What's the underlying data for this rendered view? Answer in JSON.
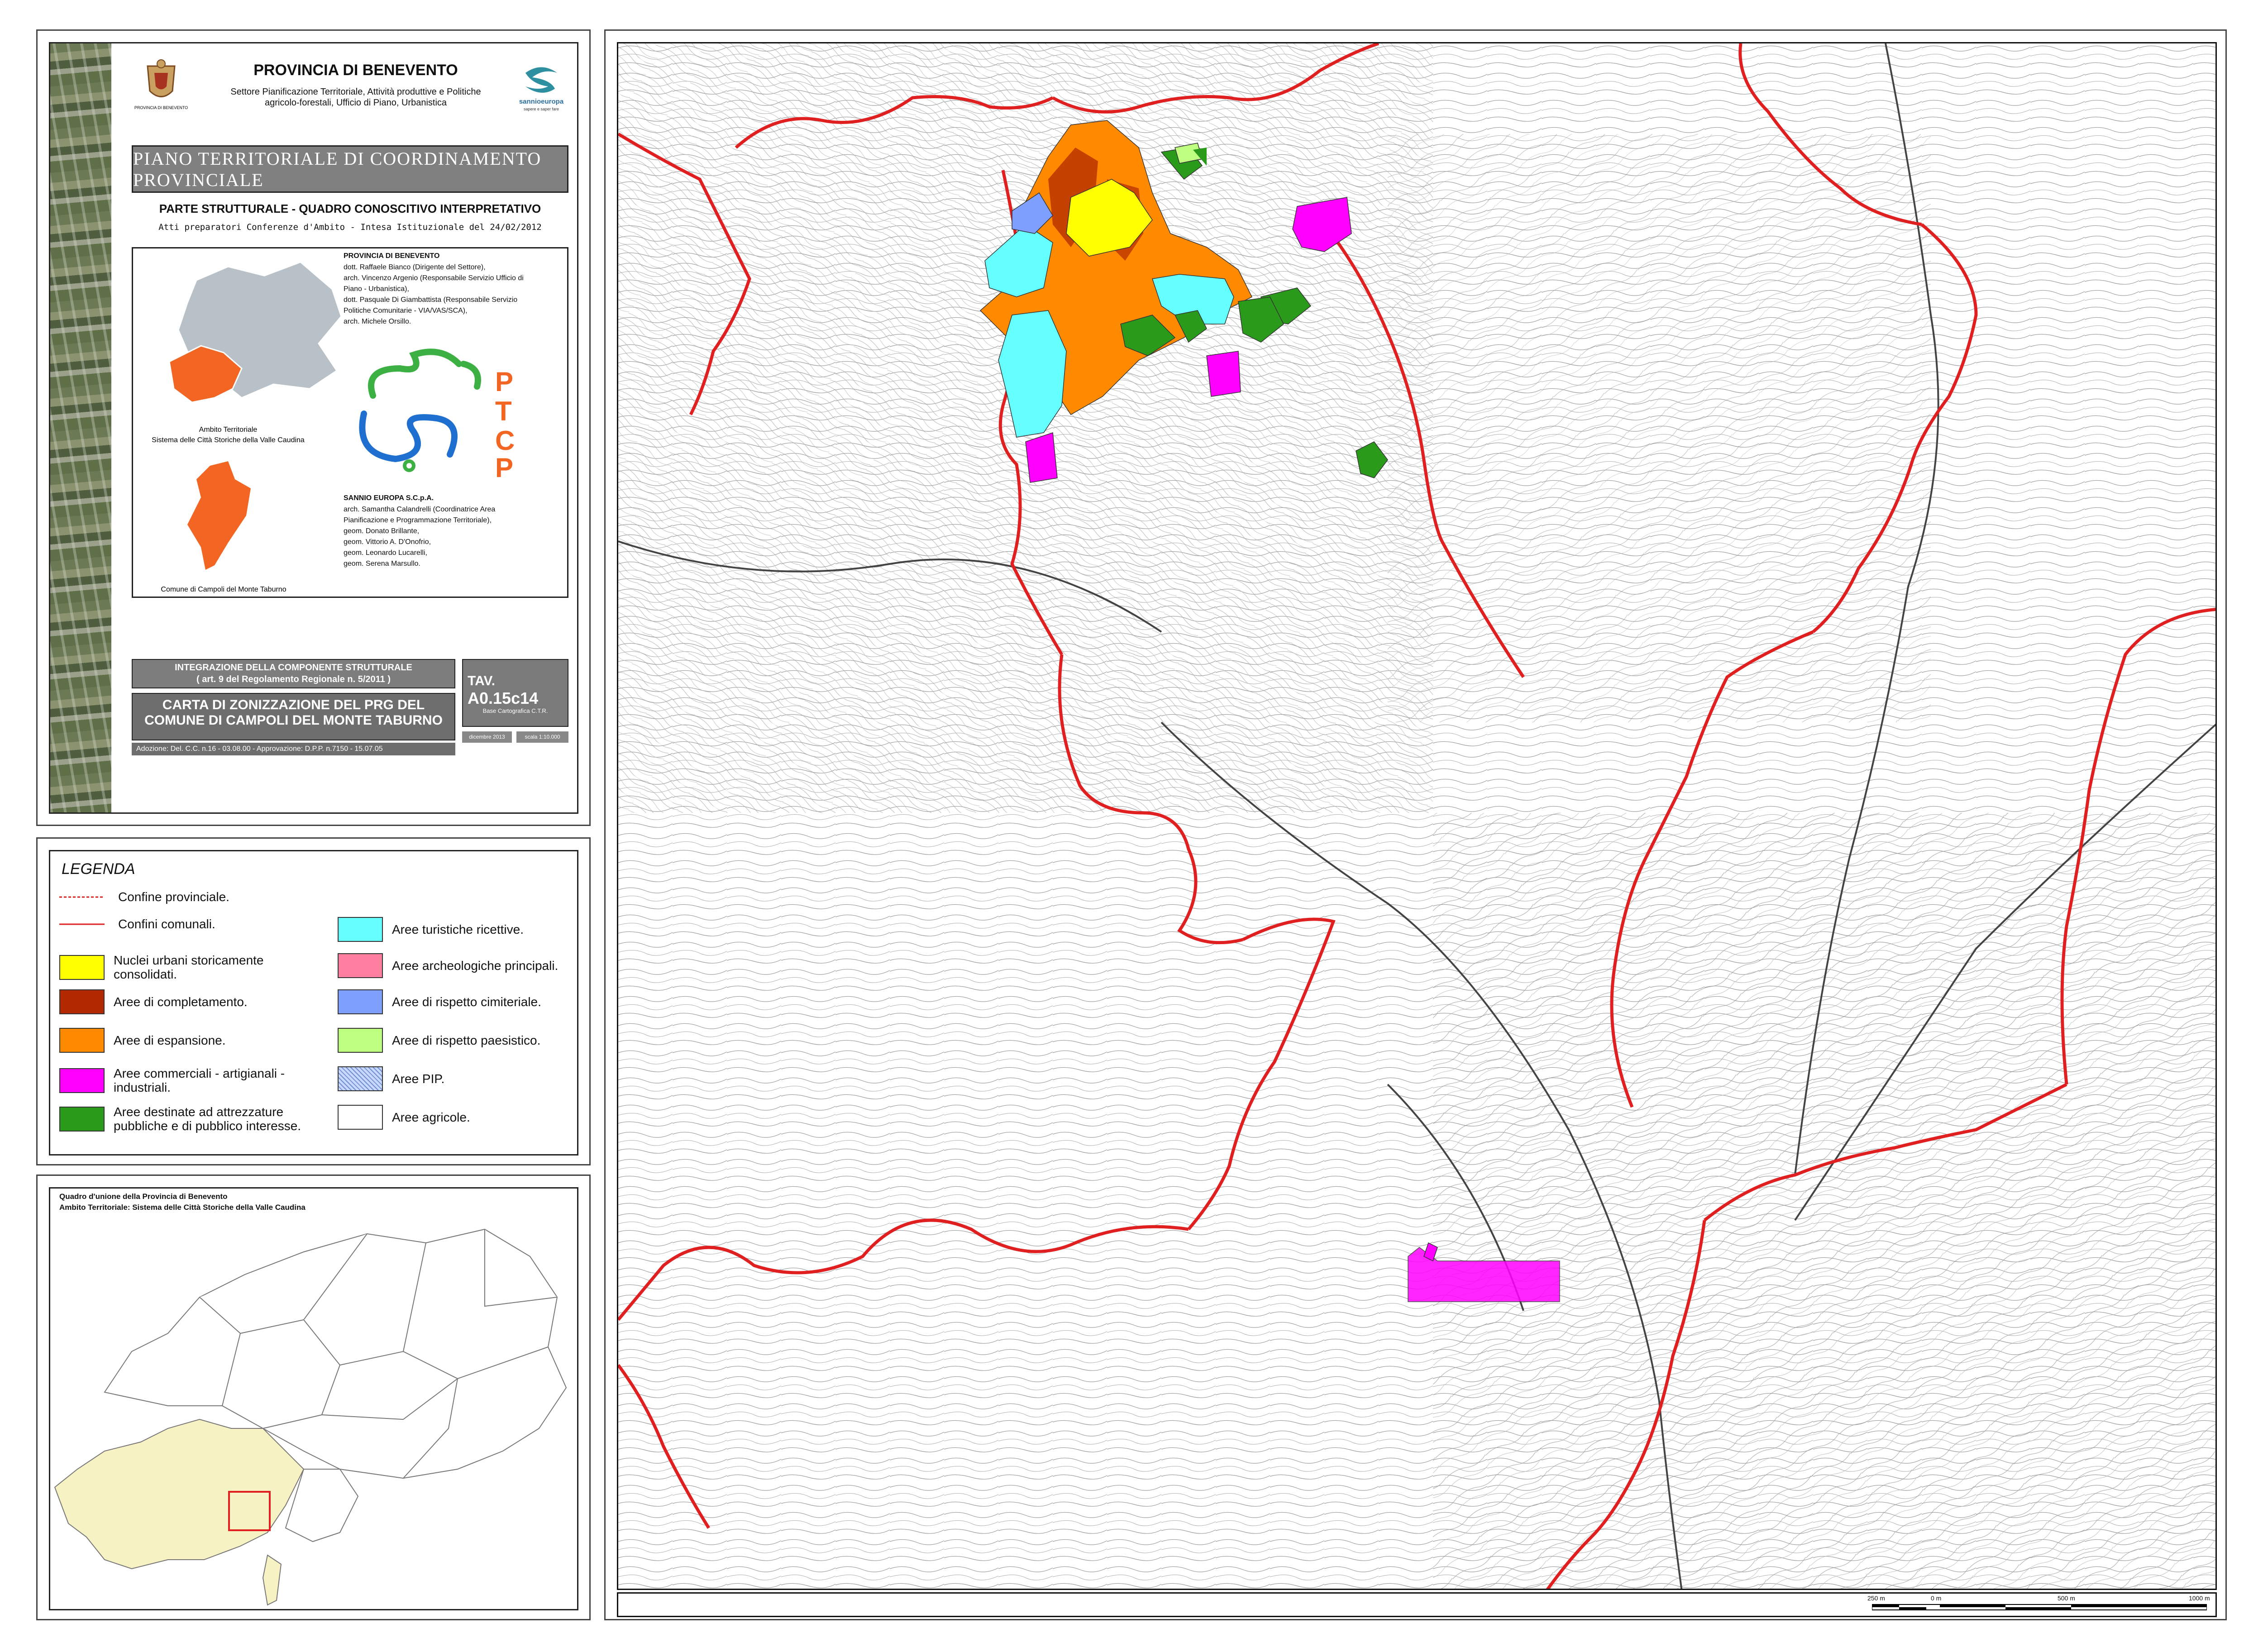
{
  "header": {
    "province_title": "PROVINCIA DI BENEVENTO",
    "emblem_caption": "PROVINCIA DI BENEVENTO",
    "department_line1": "Settore Pianificazione Territoriale, Attività produttive e Politiche",
    "department_line2": "agricolo-forestali, Ufficio di Piano, Urbanistica",
    "logo_text": "sannioeuropa",
    "logo_tagline": "sapere e saper fare"
  },
  "plan": {
    "banner_text": "PIANO TERRITORIALE DI COORDINAMENTO PROVINCIALE",
    "section_title": "PARTE STRUTTURALE - QUADRO CONOSCITIVO INTERPRETATIVO",
    "atti_text": "Atti preparatori Conferenze d'Ambito - Intesa Istituzionale del 24/02/2012"
  },
  "credits": {
    "ambito_caption_1": "Ambito Territoriale",
    "ambito_caption_2": "Sistema delle Città Storiche della Valle Caudina",
    "comune_caption": "Comune di Campoli del Monte Taburno",
    "province_heading": "PROVINCIA DI BENEVENTO",
    "province_lines": [
      "dott. Raffaele Bianco (Dirigente del Settore),",
      "arch. Vincenzo Argenio (Responsabile Servizio Ufficio di",
      "Piano - Urbanistica),",
      "dott. Pasquale Di Giambattista (Responsabile Servizio",
      "Politiche Comunitarie - VIA/VAS/SCA),",
      "arch. Michele Orsillo."
    ],
    "ptcp_letters": [
      "P",
      "T",
      "C",
      "P"
    ],
    "sannio_heading": "SANNIO EUROPA S.C.p.A.",
    "sannio_lines": [
      "arch. Samantha Calandrelli (Coordinatrice Area",
      "Pianificazione e Programmazione Territoriale),",
      "geom. Donato Brillante,",
      "geom. Vittorio A. D'Onofrio,",
      "geom. Leonardo Lucarelli,",
      "geom. Serena Marsullo."
    ]
  },
  "titleblock": {
    "integrazione_1": "INTEGRAZIONE DELLA COMPONENTE STRUTTURALE",
    "integrazione_2": "( art. 9 del Regolamento Regionale n. 5/2011 )",
    "carta_1": "CARTA DI ZONIZZAZIONE DEL PRG DEL",
    "carta_2": "COMUNE DI CAMPOLI DEL MONTE TABURNO",
    "adozione": "Adozione: Del. C.C. n.16 - 03.08.00 - Approvazione: D.P.P. n.7150 - 15.07.05",
    "tav_prefix": "TAV.",
    "tav_code": "A0.15c14",
    "base": "Base Cartografica C.T.R.",
    "date": "dicembre 2013",
    "scale": "scala 1:10.000"
  },
  "legend": {
    "title": "LEGENDA",
    "lines": [
      {
        "label": "Confine provinciale.",
        "color": "#e02020",
        "style": "dashed"
      },
      {
        "label": "Confini comunali.",
        "color": "#e02020",
        "style": "solid"
      }
    ],
    "left_items": [
      {
        "label": "Nuclei urbani storicamente consolidati.",
        "color": "#ffff00"
      },
      {
        "label": "Aree di completamento.",
        "color": "#b22800"
      },
      {
        "label": "Aree di espansione.",
        "color": "#ff8a00"
      },
      {
        "label": "Aree commerciali - artigianali - industriali.",
        "color": "#ff00ff"
      },
      {
        "label": "Aree destinate ad attrezzature pubbliche e di pubblico interesse.",
        "color": "#2a9a1a"
      }
    ],
    "right_items": [
      {
        "label": "Aree turistiche ricettive.",
        "color": "#66ffff"
      },
      {
        "label": "Aree archeologiche principali.",
        "color": "#ff7fa0"
      },
      {
        "label": "Aree di rispetto cimiteriale.",
        "color": "#7f9fff"
      },
      {
        "label": "Aree di rispetto paesistico.",
        "color": "#bfff7f"
      },
      {
        "label": "Aree PIP.",
        "color": "#c8d8ff"
      },
      {
        "label": "Aree agricole.",
        "color": "#ffffff"
      }
    ]
  },
  "keymap": {
    "title_1": "Quadro d'unione della Provincia di Benevento",
    "title_2": "Ambito Territoriale: Sistema delle Città Storiche della Valle Caudina"
  },
  "scalebar": {
    "labels": [
      "250 m",
      "0 m",
      "500 m",
      "1000 m"
    ]
  },
  "colors": {
    "boundary_red": "#e02020",
    "ambito_orange": "#f26522",
    "province_grey": "#b8c0c8",
    "ambito_yellow": "#f7f2c4",
    "panel_grey": "#7a7a7a"
  }
}
